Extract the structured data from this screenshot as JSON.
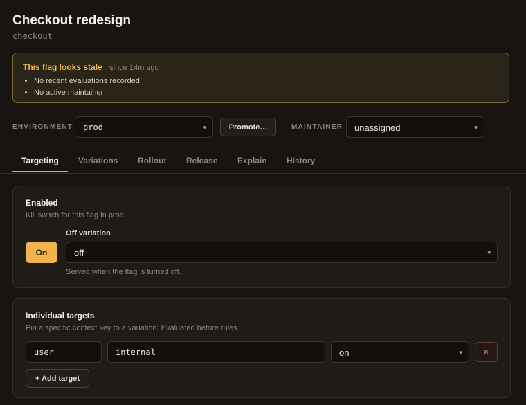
{
  "flag": {
    "name": "Checkout redesign",
    "key": "checkout"
  },
  "stale_banner": {
    "title": "This flag looks stale",
    "since": "since 14m ago",
    "reasons": [
      "No recent evaluations recorded",
      "No active maintainer"
    ]
  },
  "toolbar": {
    "environment_label": "ENVIRONMENT",
    "environment_value": "prod",
    "promote_label": "Promote…",
    "maintainer_label": "MAINTAINER",
    "maintainer_value": "unassigned"
  },
  "tabs": [
    {
      "label": "Targeting",
      "active": true
    },
    {
      "label": "Variations"
    },
    {
      "label": "Rollout"
    },
    {
      "label": "Release"
    },
    {
      "label": "Explain"
    },
    {
      "label": "History"
    }
  ],
  "enabled_card": {
    "title": "Enabled",
    "subtitle": "Kill switch for this flag in prod.",
    "toggle_label": "On",
    "off_variation_label": "Off variation",
    "off_variation_value": "off",
    "off_variation_hint": "Served when the flag is turned off."
  },
  "targets_card": {
    "title": "Individual targets",
    "subtitle": "Pin a specific context key to a variation. Evaluated before rules.",
    "rows": [
      {
        "context_kind": "user",
        "key": "internal",
        "variation": "on",
        "remove_label": "×"
      }
    ],
    "add_label": "+ Add target"
  },
  "colors": {
    "accent": "#f2b24e",
    "warning_text": "#f0b848",
    "danger": "#ef6f61",
    "background": "#171411"
  },
  "icons": {
    "select_chevron": "chevron-down-icon",
    "remove": "close-icon"
  }
}
